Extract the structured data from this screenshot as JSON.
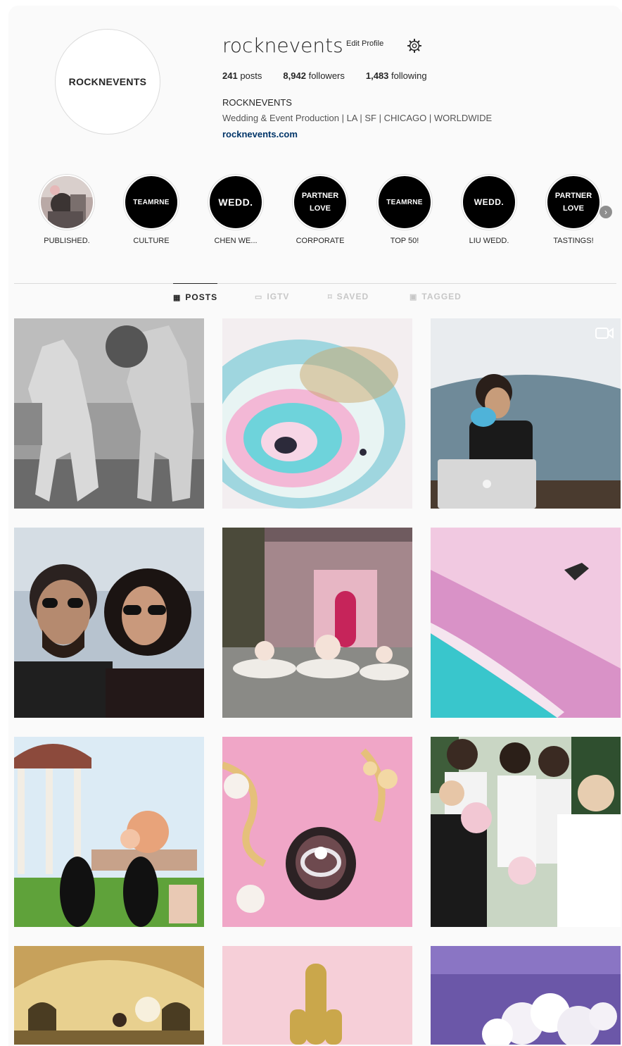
{
  "profile": {
    "avatar_text": "ROCKNEVENTS",
    "username": "rocknevents",
    "edit_label": "Edit Profile",
    "posts_count": "241",
    "posts_label": "posts",
    "followers_count": "8,942",
    "followers_label": "followers",
    "following_count": "1,483",
    "following_label": "following",
    "name": "ROCKNEVENTS",
    "bio": "Wedding & Event Production | LA | SF | CHICAGO | WORLDWIDE",
    "website": "rocknevents.com"
  },
  "highlights": [
    {
      "label": "PUBLISHED.",
      "cover": "photo"
    },
    {
      "label": "CULTURE",
      "cover_text": "TEAMRNE"
    },
    {
      "label": "CHEN WE...",
      "cover_text": "WEDD."
    },
    {
      "label": "CORPORATE",
      "cover_text": "PARTNER LOVE"
    },
    {
      "label": "TOP 50!",
      "cover_text": "TEAMRNE"
    },
    {
      "label": "LIU WEDD.",
      "cover_text": "WEDD."
    },
    {
      "label": "TASTINGS!",
      "cover_text": "PARTNER LOVE"
    }
  ],
  "tabs": [
    {
      "label": "POSTS",
      "icon": "grid-icon",
      "active": true
    },
    {
      "label": "IGTV",
      "icon": "tv-icon",
      "active": false
    },
    {
      "label": "SAVED",
      "icon": "bookmark-icon",
      "active": false
    },
    {
      "label": "TAGGED",
      "icon": "tag-icon",
      "active": false
    }
  ],
  "posts": [
    {
      "subject": "horses"
    },
    {
      "subject": "agate"
    },
    {
      "subject": "woman-laptop",
      "video": true
    },
    {
      "subject": "couple-selfie"
    },
    {
      "subject": "venue-night"
    },
    {
      "subject": "pink-beach"
    },
    {
      "subject": "gazebo-table"
    },
    {
      "subject": "ring"
    },
    {
      "subject": "bridesmaids"
    },
    {
      "subject": "ballroom"
    },
    {
      "subject": "glitter-hand"
    },
    {
      "subject": "white-flowers"
    }
  ]
}
